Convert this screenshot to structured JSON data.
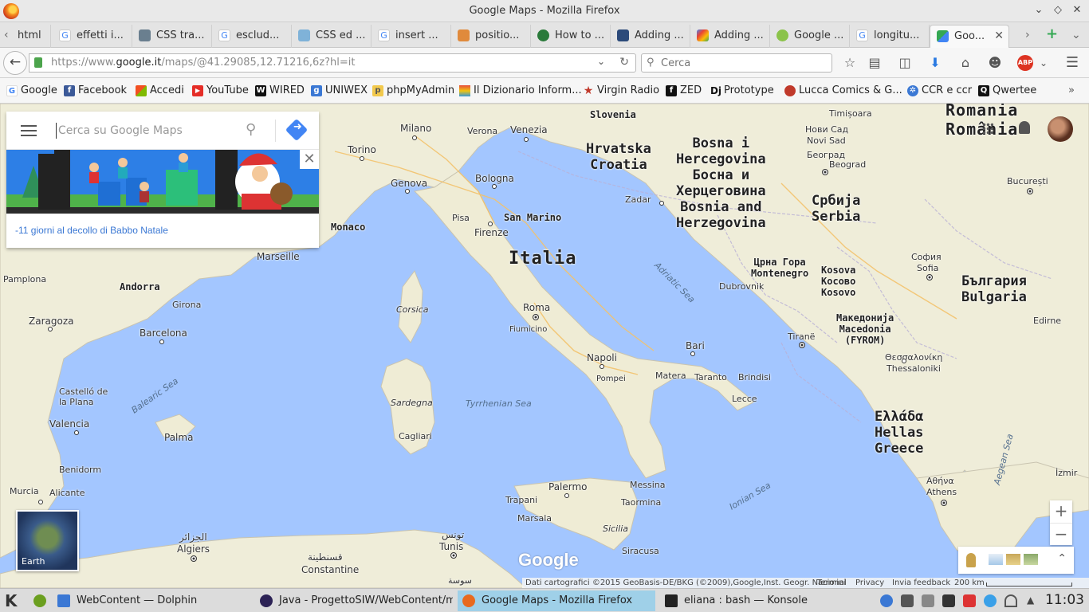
{
  "window": {
    "title": "Google Maps - Mozilla Firefox"
  },
  "tabs": [
    {
      "label": "html"
    },
    {
      "label": "effetti i..."
    },
    {
      "label": "CSS tra..."
    },
    {
      "label": "esclud..."
    },
    {
      "label": "CSS ed ..."
    },
    {
      "label": "insert ..."
    },
    {
      "label": "positio..."
    },
    {
      "label": "How to ..."
    },
    {
      "label": "Adding ..."
    },
    {
      "label": "Adding ..."
    },
    {
      "label": "Google ..."
    },
    {
      "label": "longitu..."
    },
    {
      "label": "Goo..."
    }
  ],
  "navbar": {
    "url_prefix": "https://www.",
    "url_domain": "google.it",
    "url_path": "/maps/@41.29085,12.71216,6z?hl=it",
    "search_placeholder": "Cerca"
  },
  "bookmarks": [
    {
      "label": "Google",
      "color": "#4285f4",
      "glyph": "G"
    },
    {
      "label": "Facebook",
      "color": "#3b5998",
      "glyph": "f"
    },
    {
      "label": "Accedi",
      "color": "#e74c3c",
      "glyph": "▦"
    },
    {
      "label": "YouTube",
      "color": "#e52d27",
      "glyph": "▶"
    },
    {
      "label": "WIRED",
      "color": "#111111",
      "glyph": "W"
    },
    {
      "label": "UNIWEX",
      "color": "#3b78d4",
      "glyph": "g"
    },
    {
      "label": "phpMyAdmin",
      "color": "#e8a93a",
      "glyph": "p"
    },
    {
      "label": "Il Dizionario Inform...",
      "color": "#d9a31f",
      "glyph": "▲"
    },
    {
      "label": "Virgin Radio",
      "color": "#c0392b",
      "glyph": "★"
    },
    {
      "label": "ZED",
      "color": "#111111",
      "glyph": "f"
    },
    {
      "label": "Prototype",
      "color": "#ffffff",
      "glyph": "Dj"
    },
    {
      "label": "Lucca Comics & G...",
      "color": "#c0392b",
      "glyph": "●"
    },
    {
      "label": "CCR e ccr",
      "color": "#3b78d4",
      "glyph": "✲"
    },
    {
      "label": "Qwertee",
      "color": "#111111",
      "glyph": "Q"
    }
  ],
  "maps": {
    "search_placeholder": "Cerca su Google Maps",
    "doodle_message": "-11 giorni al decollo di Babbo Natale",
    "earth_label": "Earth",
    "zoom_in": "+",
    "zoom_out": "−",
    "logo": "Google",
    "attribution": "Dati cartografici ©2015 GeoBasis-DE/BKG (©2009),Google,Inst. Geogr. Nacional",
    "terms": "Termini",
    "privacy": "Privacy",
    "feedback": "Invia feedback",
    "scale": "200 km"
  },
  "map_labels": {
    "countries": [
      {
        "text": "Italia"
      },
      {
        "text": "Hrvatska\nCroatia"
      },
      {
        "text": "Bosna i\nHercegovina\nБосна и\nХерцеговина\nBosnia and\nHerzegovina"
      },
      {
        "text": "Србија\nSerbia"
      },
      {
        "text": "Romania\nRomânia"
      },
      {
        "text": "Црна Гора\nMontenegro"
      },
      {
        "text": "Kosova\nКосово\nKosovo"
      },
      {
        "text": "България\nBulgaria"
      },
      {
        "text": "Македонија\nMacedonia\n(FYROM)"
      },
      {
        "text": "Ελλάδα\nHellas\nGreece"
      },
      {
        "text": "Slovenia"
      },
      {
        "text": "Andorra"
      },
      {
        "text": "Monaco"
      },
      {
        "text": "San Marino"
      }
    ],
    "cities": [
      "Milano",
      "Verona",
      "Venezia",
      "Torino",
      "Bologna",
      "Genova",
      "Pisa",
      "Firenze",
      "Marseille",
      "Roma",
      "Fiumicino",
      "Napoli",
      "Pompei",
      "Bari",
      "Matera",
      "Taranto",
      "Brindisi",
      "Lecce",
      "Corsica",
      "Sardegna",
      "Cagliari",
      "Palermo",
      "Messina",
      "Trapani",
      "Taormina",
      "Marsala",
      "Sicilia",
      "Siracusa",
      "Zadar",
      "Dubrovnik",
      "Tiranë",
      "Sofia",
      "София",
      "Beograd",
      "Београд",
      "Нови Сад",
      "Novi Sad",
      "Timișoara",
      "București",
      "Edirne",
      "Θεσσαλονίκη",
      "Thessaloniki",
      "Αθήνα",
      "Athens",
      "İzmir",
      "Barcelona",
      "Girona",
      "Zaragoza",
      "Pamplona",
      "Valencia",
      "Castelló de la Plana",
      "Palma",
      "Benidorm",
      "Alicante",
      "Murcia",
      "الجزائر",
      "Algiers",
      "تونس",
      "Tunis",
      "قسنطينة",
      "Constantine",
      "سوسة"
    ],
    "seas": [
      "Adriatic Sea",
      "Tyrrhenian Sea",
      "Ionian Sea",
      "Balearic Sea",
      "Aegean Sea"
    ]
  },
  "taskbar": {
    "tasks": [
      {
        "label": "WebContent — Dolphin"
      },
      {
        "label": "Java - ProgettoSIW/WebContent/m"
      },
      {
        "label": "Google Maps - Mozilla Firefox"
      },
      {
        "label": "eliana : bash — Konsole"
      }
    ],
    "clock": "11:03"
  },
  "colors": {
    "sea": "#a3c6ff",
    "land": "#f1efe6",
    "active_task": "#9fd0e8",
    "link": "#3b78d4"
  }
}
